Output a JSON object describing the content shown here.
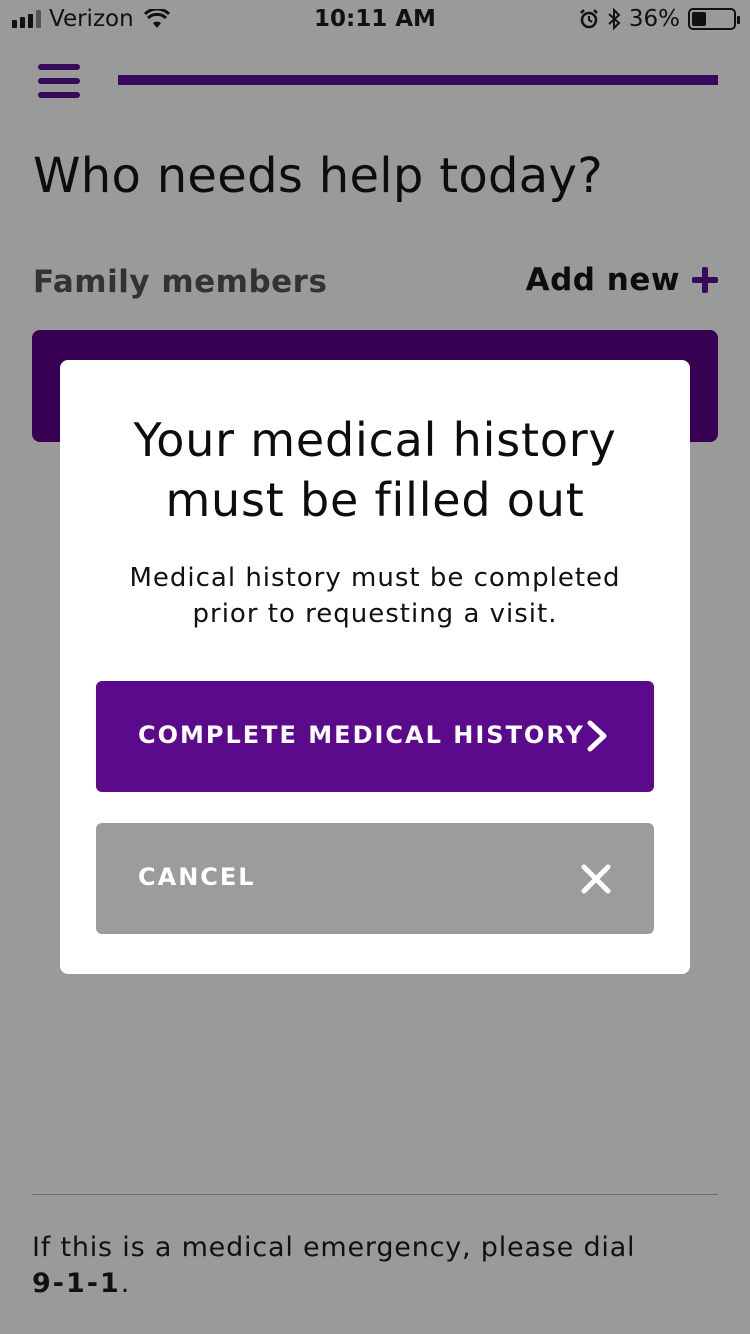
{
  "status_bar": {
    "carrier": "Verizon",
    "time": "10:11 AM",
    "battery_percent": "36%",
    "battery_level": 0.36
  },
  "header": {
    "progress": 1.0,
    "accent_color": "#3a0a5a"
  },
  "page": {
    "title": "Who needs help today?",
    "family_label": "Family members",
    "add_new_label": "Add new"
  },
  "modal": {
    "title_line1": "Your medical history",
    "title_line2": "must be filled out",
    "body_line1": "Medical history must be completed",
    "body_line2": "prior to requesting a visit.",
    "primary_button_label": "COMPLETE MEDICAL HISTORY",
    "cancel_button_label": "CANCEL",
    "primary_color": "#5c0a8c"
  },
  "footer": {
    "emergency_text": "If this is a medical emergency, please dial",
    "emergency_number": "9-1-1",
    "emergency_suffix": "."
  },
  "icons": [
    "signal-icon",
    "wifi-icon",
    "alarm-icon",
    "bluetooth-icon",
    "battery-icon",
    "menu-icon",
    "plus-icon",
    "chevron-right-icon",
    "close-icon"
  ]
}
